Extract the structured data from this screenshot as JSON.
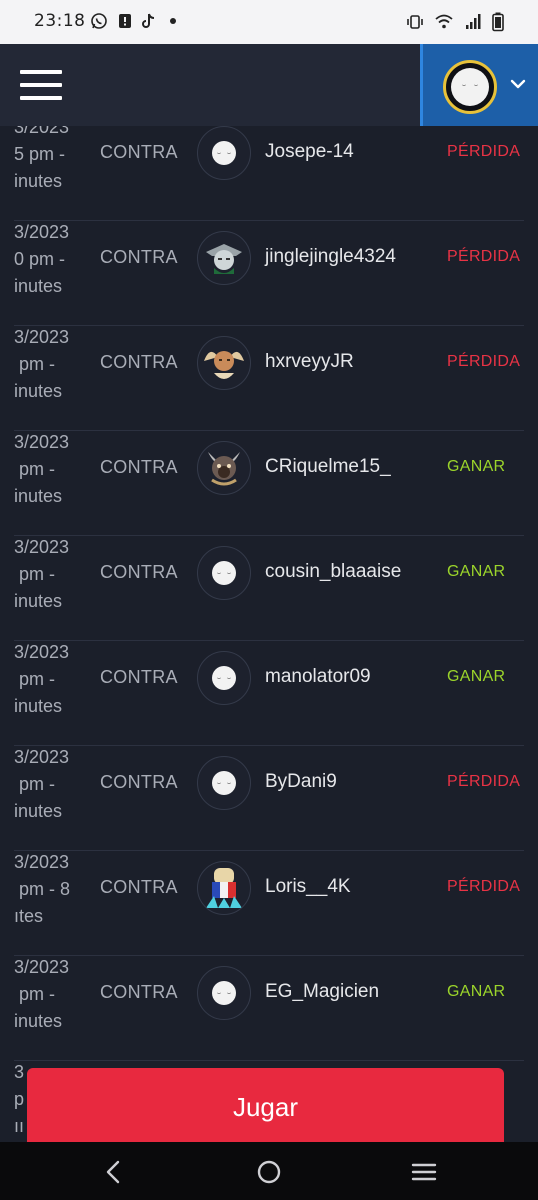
{
  "status_bar": {
    "time": "23:18",
    "left_icons": [
      "whatsapp-icon",
      "notification-icon",
      "tiktok-icon",
      "dot-icon"
    ],
    "right_icons": [
      "vibrate-icon",
      "wifi-icon",
      "signal-icon",
      "battery-icon"
    ]
  },
  "header": {
    "menu_icon": "hamburger-menu-icon",
    "profile_icon": "avatar-icon",
    "dropdown_icon": "chevron-down-icon",
    "colors": {
      "bg": "#232836",
      "profile_bg": "#1d5fa8",
      "avatar_ring": "#e8c23a"
    }
  },
  "matches": [
    {
      "date": "3/2023\n5 pm -\ninutes",
      "vs": "CONTRA",
      "username": "Josepe-14",
      "result": "PÉRDIDA",
      "outcome": "loss",
      "avatar": "default-face"
    },
    {
      "date": "3/2023\n0 pm -\ninutes",
      "vs": "CONTRA",
      "username": "jinglejingle4324",
      "result": "PÉRDIDA",
      "outcome": "loss",
      "avatar": "knight"
    },
    {
      "date": "3/2023\n pm -\ninutes",
      "vs": "CONTRA",
      "username": "hxrveyyJR",
      "result": "PÉRDIDA",
      "outcome": "loss",
      "avatar": "angel"
    },
    {
      "date": "3/2023\n pm -\ninutes",
      "vs": "CONTRA",
      "username": "CRiquelme15_",
      "result": "GANAR",
      "outcome": "win",
      "avatar": "demon"
    },
    {
      "date": "3/2023\n pm -\ninutes",
      "vs": "CONTRA",
      "username": "cousin_blaaaise",
      "result": "GANAR",
      "outcome": "win",
      "avatar": "default-face"
    },
    {
      "date": "3/2023\n pm -\ninutes",
      "vs": "CONTRA",
      "username": "manolator09",
      "result": "GANAR",
      "outcome": "win",
      "avatar": "default-face"
    },
    {
      "date": "3/2023\n pm -\ninutes",
      "vs": "CONTRA",
      "username": "ByDani9",
      "result": "PÉRDIDA",
      "outcome": "loss",
      "avatar": "default-face"
    },
    {
      "date": "3/2023\n pm - 8\nıtes",
      "vs": "CONTRA",
      "username": "Loris__4K",
      "result": "PÉRDIDA",
      "outcome": "loss",
      "avatar": "toast-france"
    },
    {
      "date": "3/2023\n pm -\ninutes",
      "vs": "CONTRA",
      "username": "EG_Magicien",
      "result": "GANAR",
      "outcome": "win",
      "avatar": "default-face"
    },
    {
      "date": "3\np\nıı",
      "vs": "",
      "username": "",
      "result": "",
      "outcome": "",
      "avatar": ""
    }
  ],
  "play_button": {
    "label": "Jugar",
    "color": "#e8293f"
  },
  "nav_bar": {
    "icons": [
      "back-icon",
      "home-icon",
      "recents-icon"
    ]
  }
}
